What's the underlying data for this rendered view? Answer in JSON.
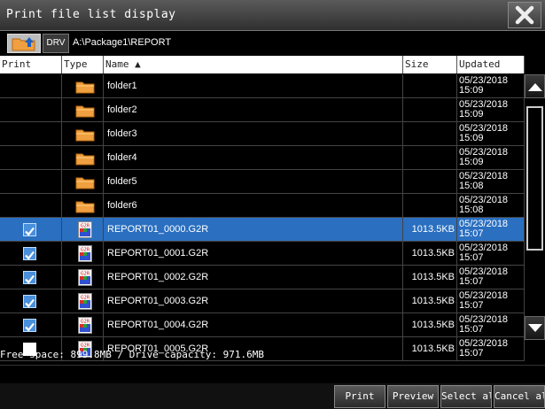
{
  "window": {
    "title": "Print file list display"
  },
  "icons": {
    "close": "close-x-icon",
    "up_folder": "folder-up-icon",
    "folder": "folder-icon",
    "file": "g2r-file-icon"
  },
  "pathbar": {
    "drive_label": "DRV",
    "path": "A:\\Package1\\REPORT"
  },
  "columns": {
    "print": "Print",
    "type": "Type",
    "name": "Name ▲",
    "size": "Size",
    "updated": "Updated"
  },
  "rows": [
    {
      "name": "folder1",
      "size": "",
      "date": "05/23/2018",
      "time": "15:09"
    },
    {
      "name": "folder2",
      "size": "",
      "date": "05/23/2018",
      "time": "15:09"
    },
    {
      "name": "folder3",
      "size": "",
      "date": "05/23/2018",
      "time": "15:09"
    },
    {
      "name": "folder4",
      "size": "",
      "date": "05/23/2018",
      "time": "15:09"
    },
    {
      "name": "folder5",
      "size": "",
      "date": "05/23/2018",
      "time": "15:08"
    },
    {
      "name": "folder6",
      "size": "",
      "date": "05/23/2018",
      "time": "15:08"
    },
    {
      "name": "REPORT01_0000.G2R",
      "size": "1013.5KB",
      "date": "05/23/2018",
      "time": "15:07"
    },
    {
      "name": "REPORT01_0001.G2R",
      "size": "1013.5KB",
      "date": "05/23/2018",
      "time": "15:07"
    },
    {
      "name": "REPORT01_0002.G2R",
      "size": "1013.5KB",
      "date": "05/23/2018",
      "time": "15:07"
    },
    {
      "name": "REPORT01_0003.G2R",
      "size": "1013.5KB",
      "date": "05/23/2018",
      "time": "15:07"
    },
    {
      "name": "REPORT01_0004.G2R",
      "size": "1013.5KB",
      "date": "05/23/2018",
      "time": "15:07"
    },
    {
      "name": "REPORT01_0005.G2R",
      "size": "1013.5KB",
      "date": "05/23/2018",
      "time": "15:07"
    }
  ],
  "row_types": [
    "folder",
    "folder",
    "folder",
    "folder",
    "folder",
    "folder",
    "file",
    "file",
    "file",
    "file",
    "file",
    "file"
  ],
  "row_checked": [
    null,
    null,
    null,
    null,
    null,
    null,
    true,
    true,
    true,
    true,
    true,
    false
  ],
  "selected_row": 6,
  "status": "Free space: 899.8MB / Drive capacity: 971.6MB",
  "buttons": {
    "print": "Print",
    "preview": "Preview",
    "select_all": "Select all",
    "cancel_all": "Cancel all"
  },
  "colors": {
    "selected_row": "#2a6fc0",
    "checkbox_on": "#4a8fdc",
    "folder": "#f0a040"
  }
}
